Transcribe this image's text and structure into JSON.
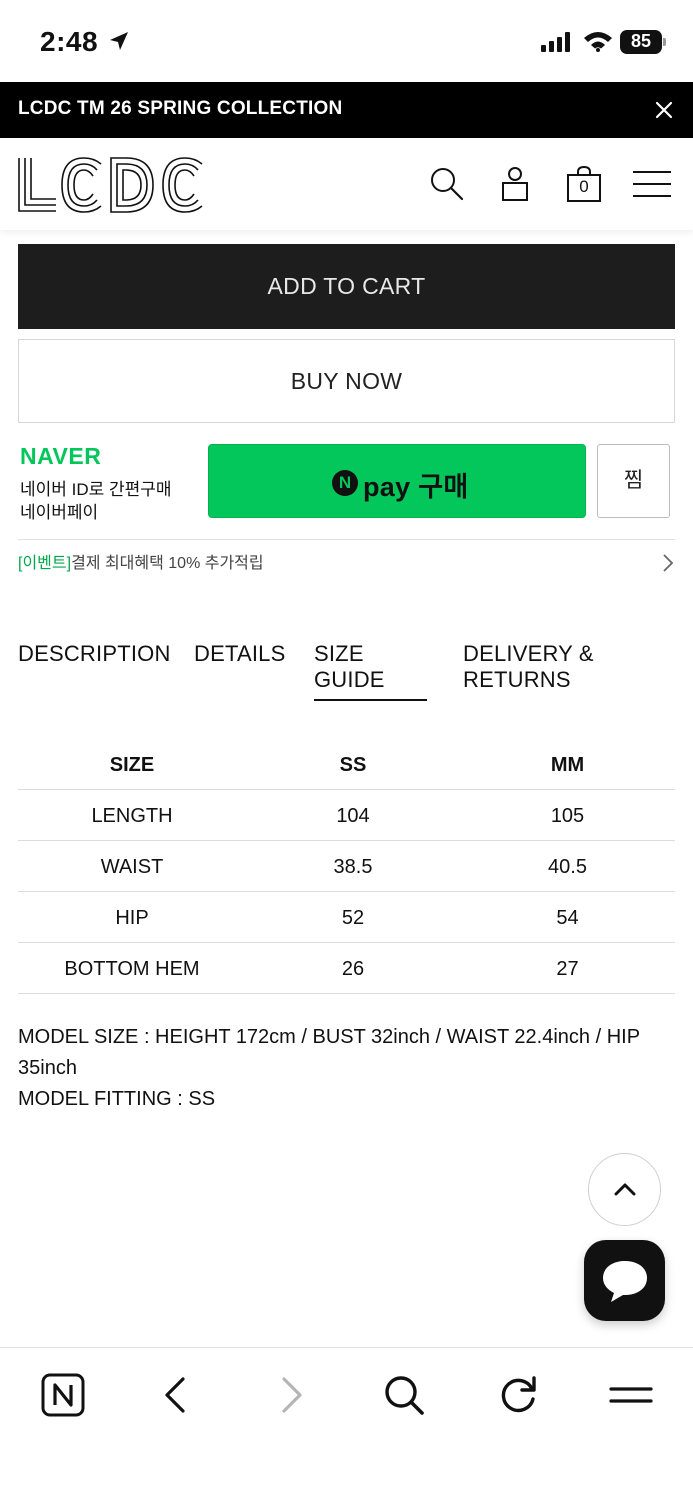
{
  "status_bar": {
    "time": "2:48",
    "battery": "85"
  },
  "announcement": {
    "text": "LCDC TM 26 SPRING COLLECTION"
  },
  "header": {
    "logo": "LCDC",
    "cart_count": "0"
  },
  "actions": {
    "add_to_cart": "ADD TO CART",
    "buy_now": "BUY NOW"
  },
  "naver_pay": {
    "brand": "NAVER",
    "line1": "네이버 ID로 간편구매",
    "line2": "네이버페이",
    "button_n": "N",
    "button_label": "pay 구매",
    "wish_label": "찜",
    "accent_color": "#03c75a"
  },
  "event": {
    "tag": "[이벤트]",
    "text": "결제 최대혜택 10% 추가적립"
  },
  "tabs": [
    {
      "label": "DESCRIPTION",
      "active": false
    },
    {
      "label": "DETAILS",
      "active": false
    },
    {
      "label": "SIZE GUIDE",
      "active": true
    },
    {
      "label": "DELIVERY & RETURNS",
      "active": false
    }
  ],
  "size_table": {
    "headers": [
      "SIZE",
      "SS",
      "MM"
    ],
    "rows": [
      [
        "LENGTH",
        "104",
        "105"
      ],
      [
        "WAIST",
        "38.5",
        "40.5"
      ],
      [
        "HIP",
        "52",
        "54"
      ],
      [
        "BOTTOM HEM",
        "26",
        "27"
      ]
    ]
  },
  "model_info": {
    "size_line": "MODEL SIZE : HEIGHT 172cm / BUST 32inch / WAIST 22.4inch / HIP 35inch",
    "fitting_line": "MODEL FITTING : SS"
  },
  "icons": {
    "status": [
      "location-arrow-icon",
      "signal-icon",
      "wifi-icon",
      "battery-icon"
    ],
    "header": [
      "search-icon",
      "user-icon",
      "shopping-bag-icon",
      "hamburger-menu-icon"
    ],
    "browser": [
      "naver-home-icon",
      "back-arrow-icon",
      "forward-arrow-icon",
      "search-icon",
      "reload-icon",
      "menu-icon"
    ]
  }
}
